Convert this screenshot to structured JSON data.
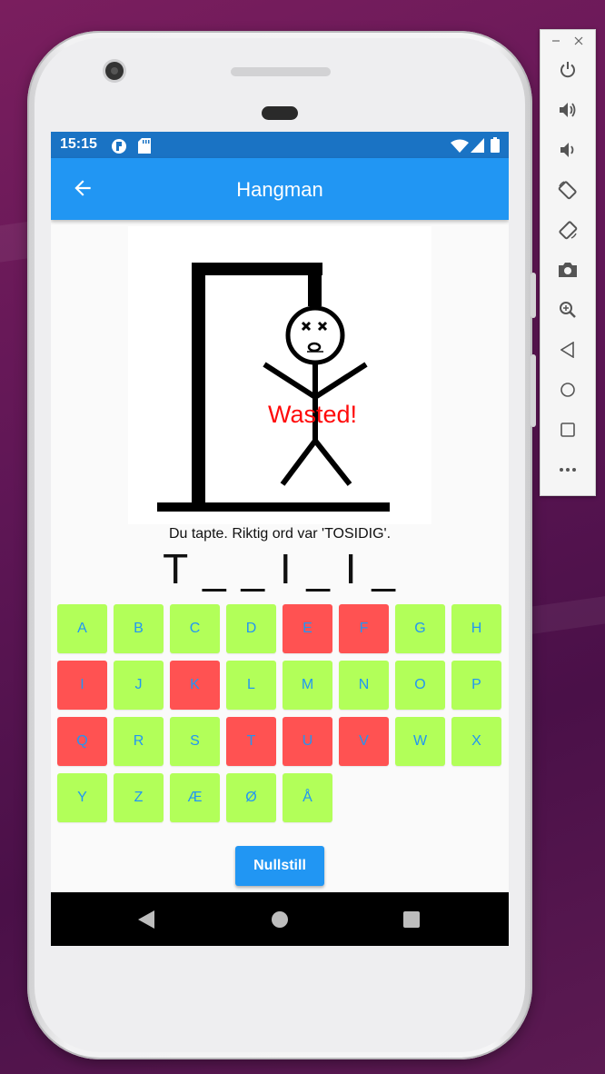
{
  "status_bar": {
    "time": "15:15"
  },
  "app_bar": {
    "title": "Hangman"
  },
  "drawing": {
    "overlay_text": "Wasted!"
  },
  "game": {
    "message": "Du tapte. Riktig ord var 'TOSIDIG'.",
    "word_display": "T _ _ I _ I _"
  },
  "keyboard": {
    "keys": [
      {
        "letter": "A",
        "state": "available"
      },
      {
        "letter": "B",
        "state": "available"
      },
      {
        "letter": "C",
        "state": "available"
      },
      {
        "letter": "D",
        "state": "available"
      },
      {
        "letter": "E",
        "state": "wrong"
      },
      {
        "letter": "F",
        "state": "wrong"
      },
      {
        "letter": "G",
        "state": "available"
      },
      {
        "letter": "H",
        "state": "available"
      },
      {
        "letter": "I",
        "state": "wrong"
      },
      {
        "letter": "J",
        "state": "available"
      },
      {
        "letter": "K",
        "state": "wrong"
      },
      {
        "letter": "L",
        "state": "available"
      },
      {
        "letter": "M",
        "state": "available"
      },
      {
        "letter": "N",
        "state": "available"
      },
      {
        "letter": "O",
        "state": "available"
      },
      {
        "letter": "P",
        "state": "available"
      },
      {
        "letter": "Q",
        "state": "wrong"
      },
      {
        "letter": "R",
        "state": "available"
      },
      {
        "letter": "S",
        "state": "available"
      },
      {
        "letter": "T",
        "state": "wrong"
      },
      {
        "letter": "U",
        "state": "wrong"
      },
      {
        "letter": "V",
        "state": "wrong"
      },
      {
        "letter": "W",
        "state": "available"
      },
      {
        "letter": "X",
        "state": "available"
      },
      {
        "letter": "Y",
        "state": "available"
      },
      {
        "letter": "Z",
        "state": "available"
      },
      {
        "letter": "Æ",
        "state": "available"
      },
      {
        "letter": "Ø",
        "state": "available"
      },
      {
        "letter": "Å",
        "state": "available"
      }
    ]
  },
  "reset_button": {
    "label": "Nullstill"
  },
  "colors": {
    "primary": "#2196f3",
    "status_bar": "#1a73c4",
    "available_key": "#b2ff59",
    "wrong_key": "#ff5252",
    "overlay_text": "#ff0a0a"
  },
  "emulator_toolbar": {
    "icons": [
      "minimize-icon",
      "close-icon",
      "power-icon",
      "volume-up-icon",
      "volume-down-icon",
      "rotate-left-icon",
      "rotate-right-icon",
      "camera-icon",
      "zoom-icon",
      "back-icon",
      "home-icon",
      "overview-icon",
      "more-icon"
    ]
  }
}
